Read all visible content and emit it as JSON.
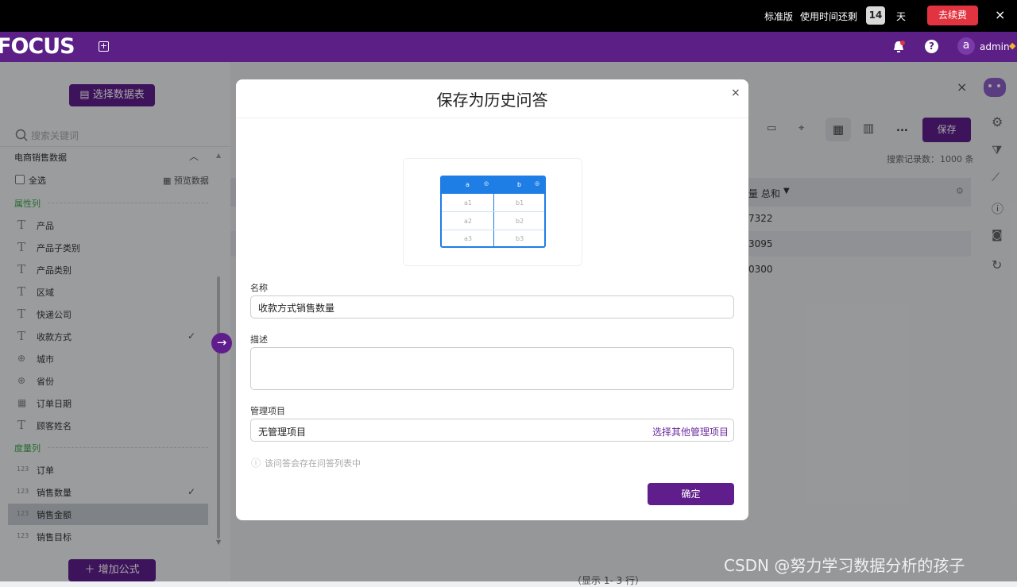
{
  "topbar": {
    "edition": "标准版",
    "remaining_label": "使用时间还剩",
    "remaining_days": "14",
    "day_unit": "天",
    "renew_button": "去续费",
    "close": "×"
  },
  "navbar": {
    "logo": "FOCUS",
    "user_initial": "a",
    "user_name": "admin"
  },
  "sidebar": {
    "select_table_button": "选择数据表",
    "search_placeholder": "搜索关键词",
    "dataset_name": "电商销售数据",
    "select_all": "全选",
    "preview_data": "预览数据",
    "attribute_section": "属性列",
    "attributes": [
      "产品",
      "产品子类别",
      "产品类别",
      "区域",
      "快递公司",
      "收款方式",
      "城市",
      "省份",
      "订单日期",
      "顾客姓名"
    ],
    "measure_section": "度量列",
    "measure_icon_text": "123",
    "measures": [
      "订单",
      "销售数量",
      "销售金额",
      "销售目标"
    ],
    "add_formula_button": "增加公式"
  },
  "main": {
    "toolbar_more": "...",
    "save_button": "保存",
    "records_label": "搜索记录数：",
    "records_value": "1000 条",
    "column_header": "量 总和",
    "rows": [
      "7322",
      "3095",
      "0300"
    ],
    "footer": "（显示 1- 3 行）"
  },
  "modal": {
    "title": "保存为历史问答",
    "close": "×",
    "preview": {
      "headers": [
        "a",
        "b"
      ],
      "cells": [
        [
          "a1",
          "b1"
        ],
        [
          "a2",
          "b2"
        ],
        [
          "a3",
          "b3"
        ]
      ]
    },
    "name_label": "名称",
    "name_value": "收款方式销售数量",
    "desc_label": "描述",
    "desc_value": "",
    "project_label": "管理项目",
    "project_value": "无管理项目",
    "project_link": "选择其他管理项目",
    "hint": "该问答会存在问答列表中",
    "confirm_button": "确定"
  },
  "watermark": "CSDN @努力学习数据分析的孩子",
  "colors": {
    "brand_purple": "#5b1f86",
    "button_purple": "#5f1e8c",
    "renew_red": "#e23340",
    "table_blue": "#1e7ee6",
    "section_green": "#3aa54a"
  }
}
